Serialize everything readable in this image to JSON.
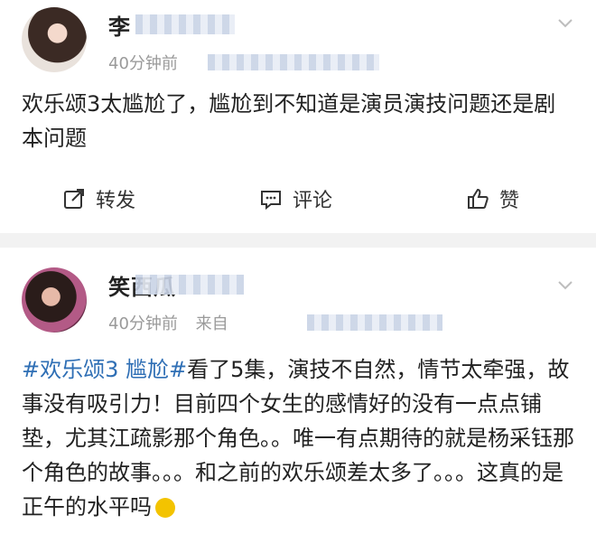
{
  "posts": [
    {
      "username": "李",
      "time": "40分钟前",
      "source": "",
      "content": "欢乐颂3太尴尬了，尴尬到不知道是演员演技问题还是剧本问题",
      "actions": {
        "repost": "转发",
        "comment": "评论",
        "like": "赞"
      }
    },
    {
      "username": "笑西瓜",
      "time": "40分钟前",
      "source": "来自",
      "hashtag": "#欢乐颂3 尴尬#",
      "content": "看了5集，演技不自然，情节太牵强，故事没有吸引力！目前四个女生的感情好的没有一点点铺垫，尤其江疏影那个角色。。唯一有点期待的就是杨采钰那个角色的故事。。。和之前的欢乐颂差太多了。。。这真的是正午的水平吗"
    }
  ],
  "colors": {
    "hashtag": "#2f6fb5",
    "meta": "#9a9a9a",
    "divider": "#f2f2f2"
  },
  "icons": [
    "avatar",
    "chevron-down-icon",
    "repost-icon",
    "comment-icon",
    "like-icon",
    "emoji-icon"
  ]
}
